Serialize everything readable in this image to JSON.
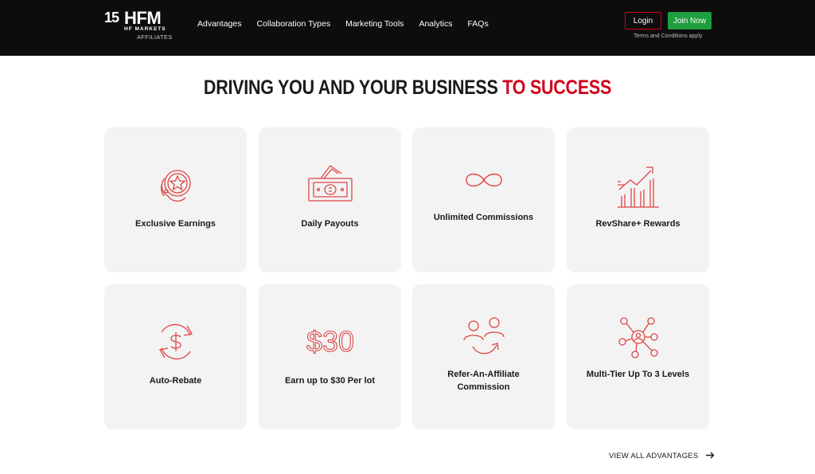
{
  "brand": {
    "anniversary": "15",
    "name": "HFM",
    "subname": "HF MARKETS",
    "tagline": "AFFILIATES",
    "accent_color": "#d0021b"
  },
  "nav": {
    "items": [
      {
        "label": "Advantages"
      },
      {
        "label": "Collaboration Types"
      },
      {
        "label": "Marketing Tools"
      },
      {
        "label": "Analytics"
      },
      {
        "label": "FAQs"
      }
    ]
  },
  "header_actions": {
    "login_label": "Login",
    "join_label": "Join Now",
    "join_color": "#1e9e3e",
    "terms_label": "Terms and Conditions apply"
  },
  "hero": {
    "title_main": "DRIVING YOU AND YOUR BUSINESS ",
    "title_accent": "TO SUCCESS"
  },
  "advantages": [
    {
      "label": "Exclusive Earnings",
      "icon": "coins-star-icon"
    },
    {
      "label": "Daily Payouts",
      "icon": "cash-stack-icon"
    },
    {
      "label": "Unlimited Commissions",
      "icon": "infinity-icon"
    },
    {
      "label": "RevShare+ Rewards",
      "icon": "growth-chart-icon"
    },
    {
      "label": "Auto-Rebate",
      "icon": "dollar-cycle-icon"
    },
    {
      "label": "Earn up to $30 Per lot",
      "icon": "dollar-30-icon",
      "icon_text": "$30"
    },
    {
      "label": "Refer-An-Affiliate Commission",
      "icon": "refer-users-icon"
    },
    {
      "label": "Multi-Tier Up To 3 Levels",
      "icon": "network-tier-icon"
    }
  ],
  "footer_link": {
    "label": "VIEW ALL ADVANTAGES",
    "icon": "arrow-right-icon"
  }
}
